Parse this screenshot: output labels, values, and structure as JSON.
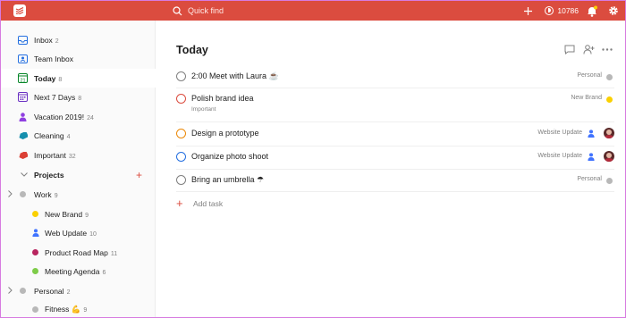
{
  "topbar": {
    "search_placeholder": "Quick find",
    "karma_count": "10786",
    "bg_color": "#db4c3f"
  },
  "sidebar": {
    "items": [
      {
        "label": "Inbox",
        "count": "2",
        "icon": "inbox-icon",
        "color": "#246fe0"
      },
      {
        "label": "Team Inbox",
        "count": "",
        "icon": "team-inbox-icon",
        "color": "#246fe0"
      },
      {
        "label": "Today",
        "count": "8",
        "icon": "today-calendar-icon",
        "color": "#058527"
      },
      {
        "label": "Next 7 Days",
        "count": "8",
        "icon": "upcoming-calendar-icon",
        "color": "#692fc2"
      },
      {
        "label": "Vacation 2019!",
        "count": "24",
        "icon": "person-icon",
        "color": "#8f3fe0"
      },
      {
        "label": "Cleaning",
        "count": "4",
        "icon": "label-tag-icon",
        "color": "#158fad"
      },
      {
        "label": "Important",
        "count": "32",
        "icon": "label-tag-icon",
        "color": "#db4035"
      }
    ],
    "projects_header": "Projects",
    "projects": [
      {
        "label": "Work",
        "count": "9",
        "color": "#b8b8b8",
        "level": 0,
        "collapsed": true
      },
      {
        "label": "New Brand",
        "count": "9",
        "color": "#fad000",
        "level": 1
      },
      {
        "label": "Web Update",
        "count": "10",
        "color": "#4073ff",
        "level": 1,
        "icon": "person-icon"
      },
      {
        "label": "Product Road Map",
        "count": "11",
        "color": "#b8255f",
        "level": 1
      },
      {
        "label": "Meeting Agenda",
        "count": "6",
        "color": "#7ecc49",
        "level": 1
      },
      {
        "label": "Personal",
        "count": "2",
        "color": "#b8b8b8",
        "level": 0,
        "collapsed": true
      },
      {
        "label": "Fitness 💪",
        "count": "9",
        "color": "#b8b8b8",
        "level": 1
      }
    ]
  },
  "main": {
    "title": "Today",
    "tasks": [
      {
        "name": "2:00 Meet with Laura ☕",
        "project": "Personal",
        "priority_color": "#808080",
        "project_color": "#b8b8b8"
      },
      {
        "name": "Polish brand idea",
        "label": "Important",
        "project": "New Brand",
        "priority_color": "#db4c3f",
        "project_color": "#fad000"
      },
      {
        "name": "Design a prototype",
        "project": "Website Update",
        "priority_color": "#eb8909",
        "assigned": true
      },
      {
        "name": "Organize photo shoot",
        "project": "Website Update",
        "priority_color": "#246fe0",
        "assigned": true
      },
      {
        "name": "Bring an umbrella ☂",
        "project": "Personal",
        "priority_color": "#808080",
        "project_color": "#b8b8b8"
      }
    ],
    "add_task_label": "Add task"
  }
}
